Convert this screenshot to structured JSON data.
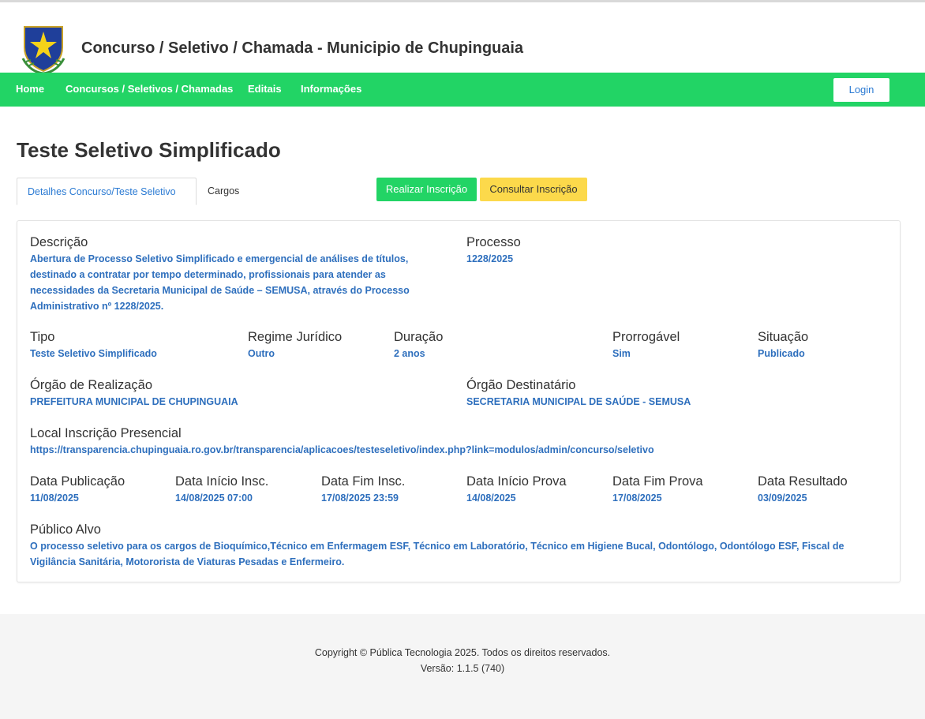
{
  "header": {
    "title": "Concurso / Seletivo / Chamada - Municipio de Chupinguaia",
    "logo_icon": "municipal-crest-icon"
  },
  "nav": {
    "items": [
      {
        "label": "Home"
      },
      {
        "label": "Concursos / Seletivos / Chamadas"
      },
      {
        "label": "Editais"
      },
      {
        "label": "Informações"
      }
    ],
    "login_label": "Login",
    "color": "#22d465"
  },
  "page": {
    "title": "Teste Seletivo Simplificado",
    "tabs": [
      {
        "label": "Detalhes Concurso/Teste Seletivo"
      },
      {
        "label": "Cargos"
      }
    ],
    "actions": {
      "realizar": "Realizar Inscrição",
      "consultar": "Consultar Inscrição"
    }
  },
  "details": {
    "descricao": {
      "label": "Descrição",
      "value": "Abertura de Processo Seletivo Simplificado e emergencial de análises de títulos, destinado a contratar por tempo determinado, profissionais para atender as necessidades da Secretaria Municipal de Saúde – SEMUSA, através do Processo Administrativo nº 1228/2025."
    },
    "processo": {
      "label": "Processo",
      "value": "1228/2025"
    },
    "tipo": {
      "label": "Tipo",
      "value": "Teste Seletivo Simplificado"
    },
    "regime": {
      "label": "Regime Jurídico",
      "value": "Outro"
    },
    "duracao": {
      "label": "Duração",
      "value": "2 anos"
    },
    "prorrogavel": {
      "label": "Prorrogável",
      "value": "Sim"
    },
    "situacao": {
      "label": "Situação",
      "value": "Publicado"
    },
    "orgao_realizacao": {
      "label": "Órgão de Realização",
      "value": "PREFEITURA MUNICIPAL DE CHUPINGUAIA"
    },
    "orgao_destinatario": {
      "label": "Órgão Destinatário",
      "value": "SECRETARIA MUNICIPAL DE SAÚDE - SEMUSA"
    },
    "local_inscricao": {
      "label": "Local Inscrição Presencial",
      "value": "https://transparencia.chupinguaia.ro.gov.br/transparencia/aplicacoes/testeseletivo/index.php?link=modulos/admin/concurso/seletivo"
    },
    "data_publicacao": {
      "label": "Data Publicação",
      "value": "11/08/2025"
    },
    "data_inicio_insc": {
      "label": "Data Início Insc.",
      "value": "14/08/2025 07:00"
    },
    "data_fim_insc": {
      "label": "Data Fim Insc.",
      "value": "17/08/2025 23:59"
    },
    "data_inicio_prova": {
      "label": "Data Início Prova",
      "value": "14/08/2025"
    },
    "data_fim_prova": {
      "label": "Data Fim Prova",
      "value": "17/08/2025"
    },
    "data_resultado": {
      "label": "Data Resultado",
      "value": "03/09/2025"
    },
    "publico_alvo": {
      "label": "Público Alvo",
      "value": "O processo seletivo para os cargos de Bioquímico,Técnico em Enfermagem ESF, Técnico em Laboratório, Técnico em Higiene Bucal, Odontólogo, Odontólogo ESF, Fiscal de Vigilância Sanitária, Motororista de Viaturas Pesadas e Enfermeiro."
    }
  },
  "footer": {
    "copyright": "Copyright © Pública Tecnologia 2025. Todos os direitos reservados.",
    "version": "Versão: 1.1.5 (740)"
  }
}
